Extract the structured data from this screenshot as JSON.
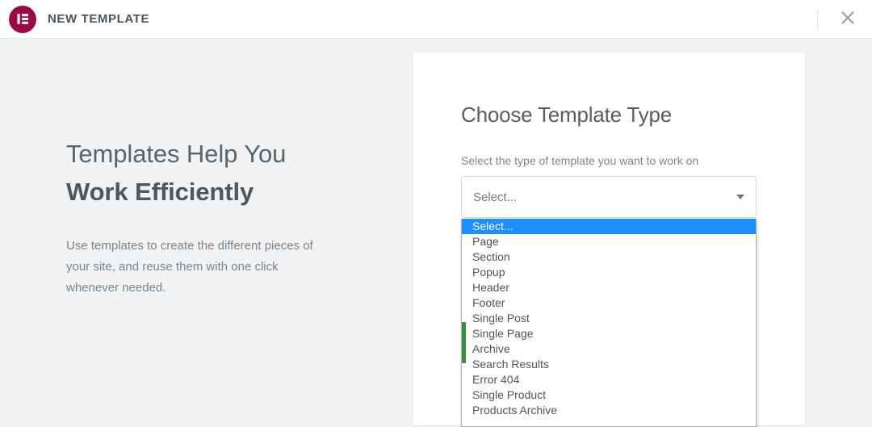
{
  "topbar": {
    "logo_icon": "elementor-logo-icon",
    "title": "NEW TEMPLATE",
    "close_icon": "close-icon"
  },
  "promo": {
    "heading_line1": "Templates Help You",
    "heading_line2": "Work Efficiently",
    "body": "Use templates to create the different pieces of your site, and reuse them with one click whenever needed."
  },
  "modal": {
    "title": "Choose Template Type",
    "subtitle": "Select the type of template you want to work on",
    "select": {
      "value": "Select...",
      "placeholder": "Select...",
      "arrow_icon": "chevron-down-icon",
      "expanded": true,
      "selected_index": 0,
      "options": [
        "Select...",
        "Page",
        "Section",
        "Popup",
        "Header",
        "Footer",
        "Single Post",
        "Single Page",
        "Archive",
        "Search Results",
        "Error 404",
        "Single Product",
        "Products Archive"
      ]
    }
  },
  "colors": {
    "brand": "#9b0a46",
    "highlight": "#1e8fff",
    "scrollbar_thumb": "#3c8c40",
    "page_bg": "#f1f2f3",
    "text": "#4b565e"
  }
}
